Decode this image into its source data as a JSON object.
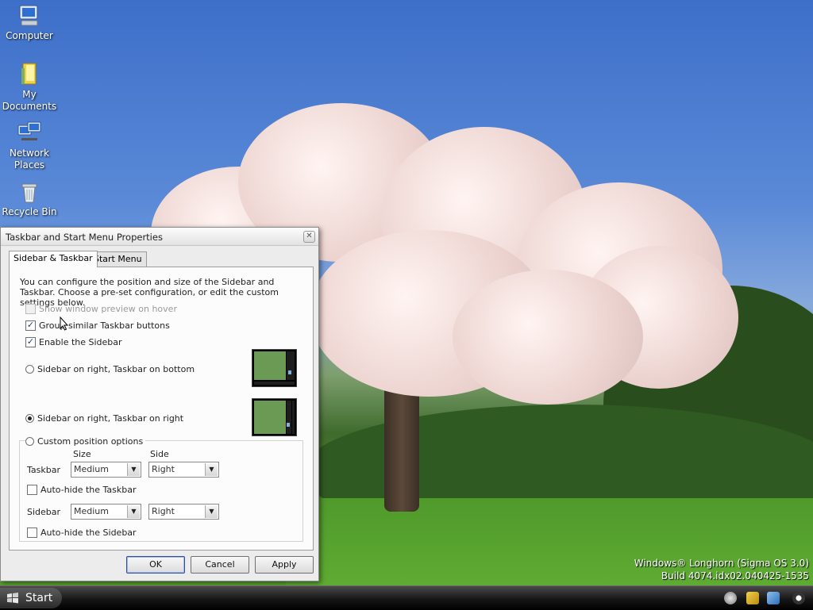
{
  "desktop": {
    "icons": [
      {
        "label": "Computer"
      },
      {
        "label": "My Documents"
      },
      {
        "label": "Network Places"
      },
      {
        "label": "Recycle Bin"
      }
    ],
    "watermark_line1": "Windows® Longhorn (Sigma OS 3.0)",
    "watermark_line2": "Build 4074.idx02.040425-1535"
  },
  "dialog": {
    "title": "Taskbar and Start Menu Properties",
    "close_glyph": "✕",
    "tabs": [
      {
        "label": "Sidebar & Taskbar",
        "active": true
      },
      {
        "label": "Start Menu",
        "active": false
      }
    ],
    "description": "You can configure the position and size of the Sidebar and Taskbar. Choose a pre-set configuration, or edit the custom settings below.",
    "options": {
      "show_preview": {
        "label": "Show window preview on hover",
        "checked": false,
        "disabled": true
      },
      "group_similar": {
        "label": "Group similar Taskbar buttons",
        "checked": true
      },
      "enable_sidebar": {
        "label": "Enable the Sidebar",
        "checked": true
      }
    },
    "layouts": {
      "right_bottom": {
        "label": "Sidebar on right, Taskbar on bottom",
        "selected": false
      },
      "right_right": {
        "label": "Sidebar on right, Taskbar on right",
        "selected": true
      },
      "custom": {
        "label": "Custom position options",
        "selected": false
      }
    },
    "custom": {
      "size_header": "Size",
      "side_header": "Side",
      "taskbar_label": "Taskbar",
      "taskbar_size": "Medium",
      "taskbar_side": "Right",
      "autohide_taskbar": {
        "label": "Auto-hide the Taskbar",
        "checked": false
      },
      "sidebar_label": "Sidebar",
      "sidebar_size": "Medium",
      "sidebar_side": "Right",
      "autohide_sidebar": {
        "label": "Auto-hide the Sidebar",
        "checked": false
      }
    },
    "buttons": {
      "ok": "OK",
      "cancel": "Cancel",
      "apply": "Apply"
    },
    "check_glyph": "✓",
    "dropdown_glyph": "▼"
  },
  "taskbar": {
    "start_label": "Start"
  },
  "colors": {
    "sky": "#3d6fc9",
    "grass": "#5aa22e",
    "blossom": "#ecd3cf",
    "taskbar": "#161616"
  }
}
